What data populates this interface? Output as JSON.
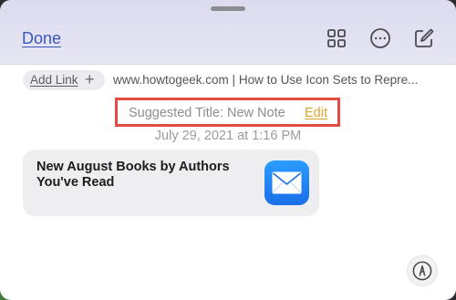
{
  "header": {
    "done_label": "Done",
    "icons": [
      "grid-icon",
      "more-options-icon",
      "compose-icon"
    ]
  },
  "link": {
    "add_link_label": "Add Link",
    "add_icon": "plus-icon",
    "url_text": "www.howtogeek.com | How to Use Icon Sets to Repre..."
  },
  "note": {
    "suggested_title": "Suggested Title: New Note",
    "edit_label": "Edit",
    "timestamp": "July 29, 2021 at 1:16 PM"
  },
  "card": {
    "title": "New August Books by Authors You've Read",
    "icon": "mail-app-icon"
  },
  "footer": {
    "markup_icon": "markup-pen-icon"
  },
  "colors": {
    "accent": "#3a58b8",
    "edit_link": "#d7a72a",
    "highlight_box": "#e24a44"
  }
}
